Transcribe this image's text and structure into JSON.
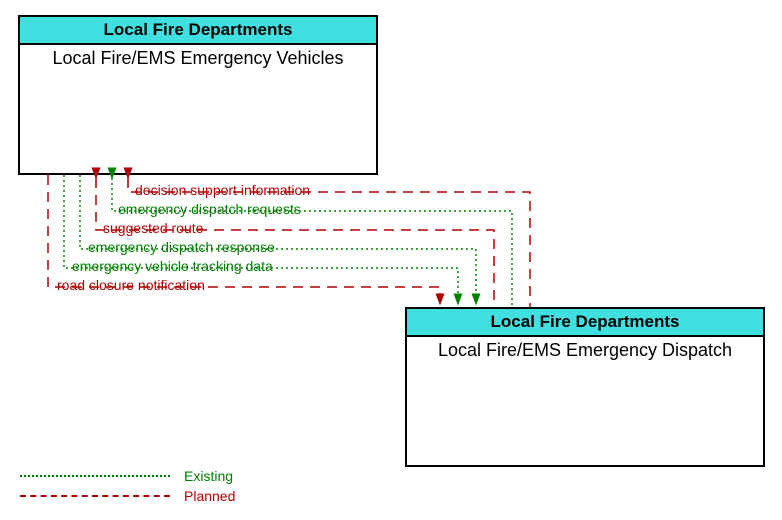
{
  "nodes": {
    "top": {
      "header": "Local Fire Departments",
      "body": "Local Fire/EMS Emergency Vehicles"
    },
    "bottom": {
      "header": "Local Fire Departments",
      "body": "Local Fire/EMS Emergency Dispatch"
    }
  },
  "flows": [
    {
      "label": "decision support information",
      "status": "planned",
      "direction": "to_top"
    },
    {
      "label": "emergency dispatch requests",
      "status": "existing",
      "direction": "to_top"
    },
    {
      "label": "suggested route",
      "status": "planned",
      "direction": "to_top"
    },
    {
      "label": "emergency dispatch response",
      "status": "existing",
      "direction": "to_bottom"
    },
    {
      "label": "emergency vehicle tracking data",
      "status": "existing",
      "direction": "to_bottom"
    },
    {
      "label": "road closure notification",
      "status": "planned",
      "direction": "to_bottom"
    }
  ],
  "legend": {
    "existing": "Existing",
    "planned": "Planned"
  },
  "colors": {
    "existing": "#008000",
    "planned": "#b00000",
    "header_bg": "#40e0e0"
  }
}
